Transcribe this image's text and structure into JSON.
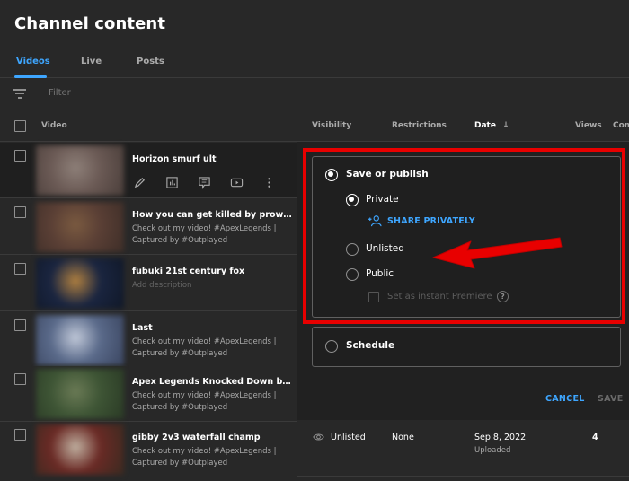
{
  "page_title": "Channel content",
  "tabs": [
    {
      "label": "Videos",
      "active": true
    },
    {
      "label": "Live",
      "active": false
    },
    {
      "label": "Posts",
      "active": false
    }
  ],
  "filter": {
    "icon": "filter-icon",
    "placeholder": "Filter"
  },
  "table_header": {
    "video": "Video",
    "visibility": "Visibility",
    "restrictions": "Restrictions",
    "date": "Date",
    "date_sort_icon": "↓",
    "views": "Views",
    "comments": "Com"
  },
  "videos": [
    {
      "title": "Horizon smurf ult",
      "description": "",
      "thumb_colors": [
        "#6b5a55",
        "#8d7f78",
        "#4a3e3a"
      ]
    },
    {
      "title": "How you can get killed by prowler",
      "description": "Check out my video! #ApexLegends | Captured by #Outplayed",
      "thumb_colors": [
        "#5a3f35",
        "#7a5a40",
        "#3e2e28"
      ]
    },
    {
      "title": "fubuki 21st century fox",
      "description": "Add description",
      "thumb_colors": [
        "#1a2540",
        "#b08040",
        "#101828"
      ]
    },
    {
      "title": "Last",
      "description": "Check out my video! #ApexLegends | Captured by #Outplayed",
      "thumb_colors": [
        "#5a6a8a",
        "#c0c8d8",
        "#3a4560"
      ]
    },
    {
      "title": "Apex Legends Knocked Down by you. ...",
      "description": "Check out my video! #ApexLegends | Captured by #Outplayed",
      "thumb_colors": [
        "#3e5535",
        "#6a7a55",
        "#2a3a25"
      ]
    },
    {
      "title": "gibby 2v3 waterfall champ",
      "description": "Check out my video! #ApexLegends | Captured by #Outplayed",
      "thumb_colors": [
        "#6a2a25",
        "#c0b0a0",
        "#3a2a20"
      ]
    }
  ],
  "row_actions": [
    "edit-icon",
    "analytics-icon",
    "comments-icon",
    "youtube-icon",
    "more-options-icon"
  ],
  "visibility_panel": {
    "save_or_publish": "Save or publish",
    "private": "Private",
    "share_privately": "SHARE PRIVATELY",
    "unlisted": "Unlisted",
    "public": "Public",
    "instant_premiere": "Set as instant Premiere",
    "help": "?",
    "schedule": "Schedule",
    "selected_mode": "save_or_publish",
    "selected_visibility": "private",
    "cancel_label": "CANCEL",
    "save_label": "SAVE"
  },
  "last_row_details": {
    "visibility": "Unlisted",
    "restrictions": "None",
    "date": "Sep 8, 2022",
    "date_status": "Uploaded",
    "views": "4"
  },
  "colors": {
    "accent": "#3ea6ff",
    "annotation_red": "#e80000",
    "background": "#282828"
  }
}
